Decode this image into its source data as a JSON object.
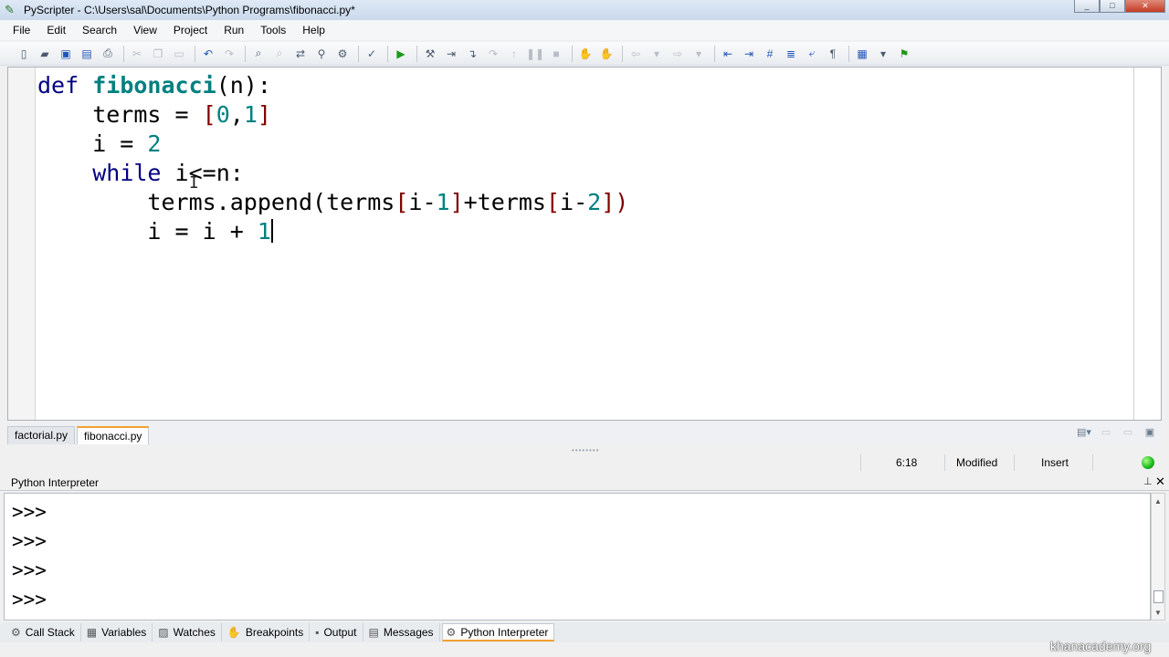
{
  "window": {
    "title": "PyScripter - C:\\Users\\sal\\Documents\\Python Programs\\fibonacci.py*",
    "controls": [
      "minimize",
      "maximize",
      "close"
    ]
  },
  "menu": [
    "File",
    "Edit",
    "Search",
    "View",
    "Project",
    "Run",
    "Tools",
    "Help"
  ],
  "editor": {
    "lines": [
      [
        {
          "t": "def",
          "c": "kw"
        },
        {
          "t": " ",
          "c": ""
        },
        {
          "t": "fibonacci",
          "c": "fn"
        },
        {
          "t": "(n):",
          "c": ""
        }
      ],
      [
        {
          "t": "    terms = ",
          "c": ""
        },
        {
          "t": "[",
          "c": "br"
        },
        {
          "t": "0",
          "c": "num"
        },
        {
          "t": ",",
          "c": ""
        },
        {
          "t": "1",
          "c": "num"
        },
        {
          "t": "]",
          "c": "br"
        }
      ],
      [
        {
          "t": "    i = ",
          "c": ""
        },
        {
          "t": "2",
          "c": "num"
        }
      ],
      [
        {
          "t": "    ",
          "c": ""
        },
        {
          "t": "while",
          "c": "kw"
        },
        {
          "t": " i<=n:",
          "c": ""
        }
      ],
      [
        {
          "t": "        terms.append(terms",
          "c": ""
        },
        {
          "t": "[",
          "c": "br"
        },
        {
          "t": "i-",
          "c": ""
        },
        {
          "t": "1",
          "c": "num"
        },
        {
          "t": "]",
          "c": "br"
        },
        {
          "t": "+terms",
          "c": ""
        },
        {
          "t": "[",
          "c": "br"
        },
        {
          "t": "i-",
          "c": ""
        },
        {
          "t": "2",
          "c": "num"
        },
        {
          "t": "]",
          "c": "br"
        },
        {
          "t": ")",
          "c": "br"
        }
      ],
      [
        {
          "t": "        i = i + ",
          "c": ""
        },
        {
          "t": "1",
          "c": "num"
        }
      ]
    ]
  },
  "file_tabs": [
    {
      "label": "factorial.py",
      "active": false
    },
    {
      "label": "fibonacci.py",
      "active": true
    }
  ],
  "status": {
    "position": "6:18",
    "modified": "Modified",
    "mode": "Insert",
    "indicator_color": "#18b818"
  },
  "interpreter": {
    "title": "Python Interpreter",
    "prompts": [
      ">>>",
      ">>>",
      ">>>",
      ">>>"
    ]
  },
  "bottom_tabs": [
    {
      "label": "Call Stack",
      "icon": "call-stack-icon",
      "active": false
    },
    {
      "label": "Variables",
      "icon": "variables-icon",
      "active": false
    },
    {
      "label": "Watches",
      "icon": "watches-icon",
      "active": false
    },
    {
      "label": "Breakpoints",
      "icon": "hand-icon",
      "active": false
    },
    {
      "label": "Output",
      "icon": "console-icon",
      "active": false
    },
    {
      "label": "Messages",
      "icon": "messages-icon",
      "active": false
    },
    {
      "label": "Python Interpreter",
      "icon": "python-icon",
      "active": true
    }
  ],
  "watermark": "khanacademy.org"
}
